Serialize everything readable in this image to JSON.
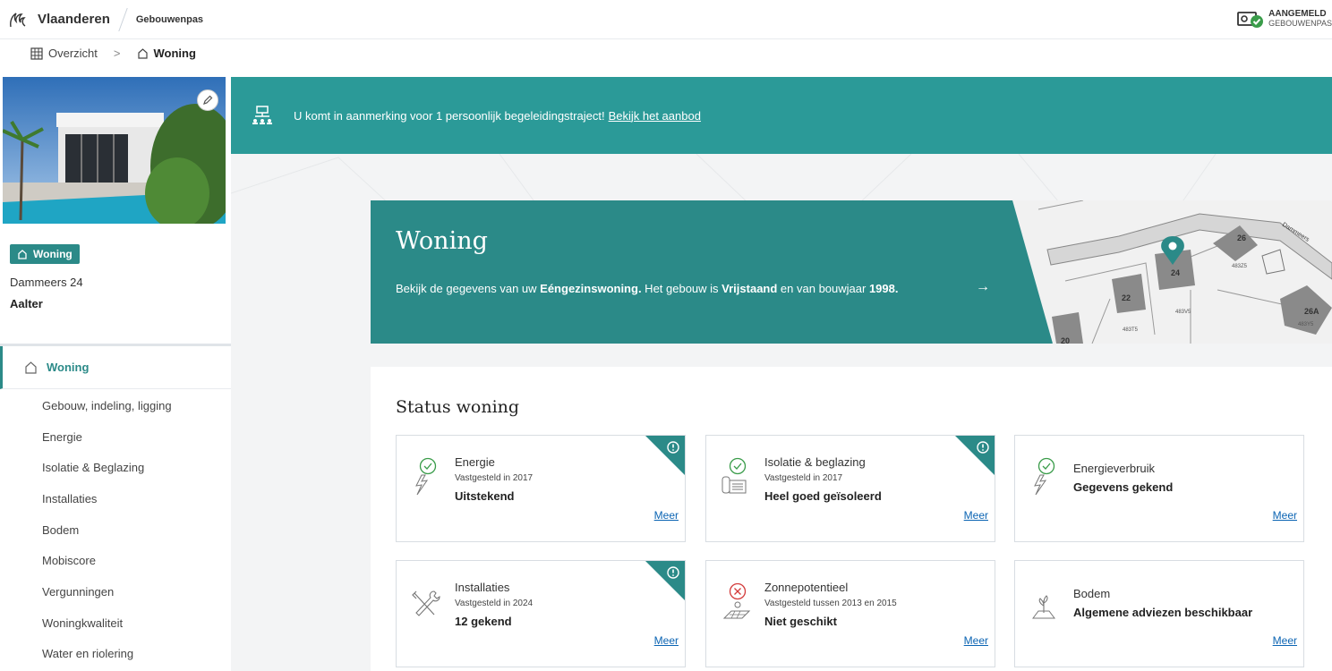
{
  "header": {
    "brand": "Vlaanderen",
    "app_name": "Gebouwenpas",
    "login_line1": "AANGEMELD",
    "login_line2": "GEBOUWENPAS"
  },
  "breadcrumb": {
    "overview": "Overzicht",
    "separator": ">",
    "current": "Woning"
  },
  "sidebar": {
    "tag_label": "Woning",
    "street": "Dammeers 24",
    "city": "Aalter",
    "main_item": "Woning",
    "items": [
      {
        "label": "Gebouw, indeling, ligging"
      },
      {
        "label": "Energie"
      },
      {
        "label": "Isolatie & Beglazing"
      },
      {
        "label": "Installaties"
      },
      {
        "label": "Bodem"
      },
      {
        "label": "Mobiscore"
      },
      {
        "label": "Vergunningen"
      },
      {
        "label": "Woningkwaliteit"
      },
      {
        "label": "Water en riolering"
      }
    ]
  },
  "banner": {
    "text": "U komt in aanmerking voor 1 persoonlijk begeleidingstraject!",
    "link": "Bekijk het aanbod"
  },
  "hero": {
    "title": "Woning",
    "desc_1": "Bekijk de gegevens van uw ",
    "desc_type": "Eéngezinswoning.",
    "desc_2": " Het gebouw is ",
    "desc_kind": "Vrijstaand",
    "desc_3": " en van bouwjaar ",
    "desc_year": "1998.",
    "arrow": "→",
    "map_labels": {
      "street": "Dammeers",
      "n26": "26",
      "n24": "24",
      "n22": "22",
      "n20": "20",
      "n26a": "26A",
      "p1": "483Z5",
      "p2": "483V5",
      "p3": "483T5",
      "p4": "483Y5"
    }
  },
  "status": {
    "title": "Status woning",
    "more_label": "Meer",
    "cards": [
      {
        "title": "Energie",
        "sub": "Vastgesteld in 2017",
        "value": "Uitstekend"
      },
      {
        "title": "Isolatie & beglazing",
        "sub": "Vastgesteld in 2017",
        "value": "Heel goed geïsoleerd"
      },
      {
        "title": "Energieverbruik",
        "value": "Gegevens gekend"
      },
      {
        "title": "Installaties",
        "sub": "Vastgesteld in 2024",
        "value": "12 gekend"
      },
      {
        "title": "Zonnepotentieel",
        "sub": "Vastgesteld tussen 2013 en 2015",
        "value": "Niet geschikt"
      },
      {
        "title": "Bodem",
        "value": "Algemene adviezen beschikbaar"
      }
    ]
  },
  "colors": {
    "teal": "#2b8a88",
    "banner_teal": "#2b9a98",
    "ok_green": "#3a9c4a",
    "error_red": "#d33a3a",
    "link_blue": "#0b64b3"
  }
}
